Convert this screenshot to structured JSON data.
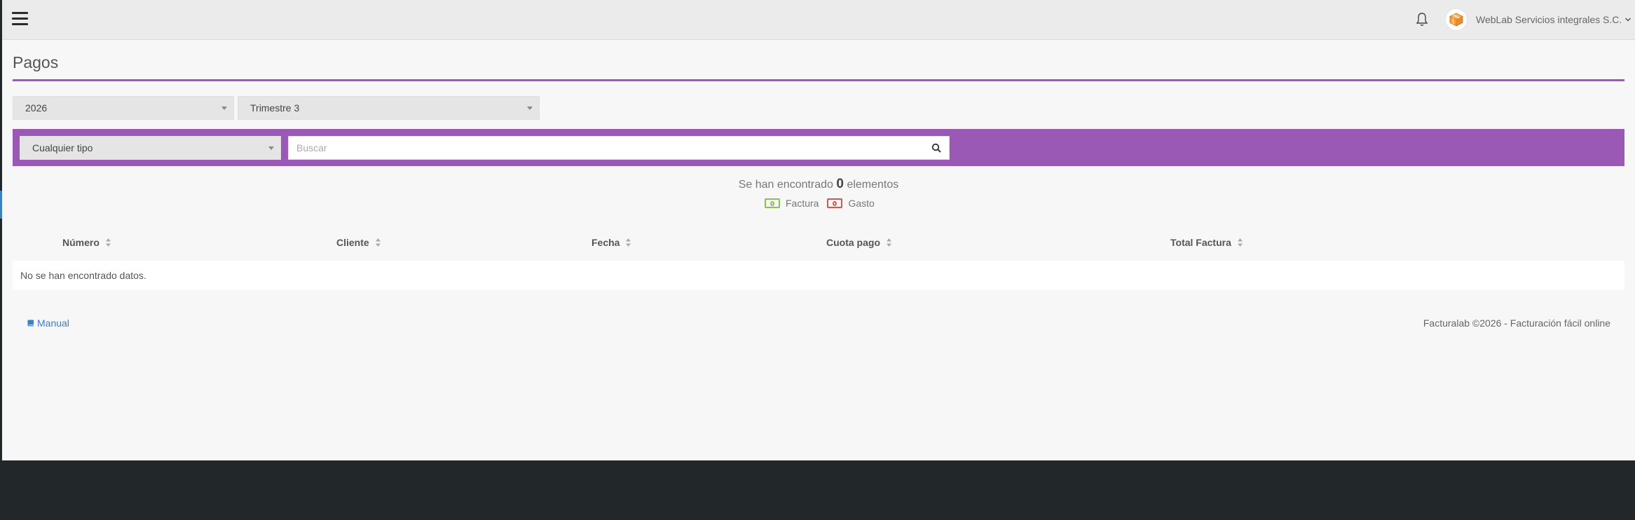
{
  "header": {
    "menu_icon": "hamburger-icon",
    "notification_icon": "bell-icon",
    "company_name": "WebLab Servicios integrales S.C.",
    "avatar_icon": "box-logo-icon"
  },
  "page_title": "Pagos",
  "filters": {
    "year": "2026",
    "quarter": "Trimestre 3",
    "type": "Cualquier tipo",
    "search_placeholder": "Buscar",
    "search_value": ""
  },
  "results": {
    "prefix": "Se han encontrado",
    "count": "0",
    "suffix": "elementos"
  },
  "legend": [
    {
      "label": "Factura",
      "color": "#8cc152",
      "icon": "money-bill-icon"
    },
    {
      "label": "Gasto",
      "color": "#d9534f",
      "icon": "money-bill-icon"
    }
  ],
  "table": {
    "columns": [
      "Número",
      "Cliente",
      "Fecha",
      "Cuota pago",
      "Total Factura"
    ],
    "empty_message": "No se han encontrado datos."
  },
  "footer": {
    "manual_label": "Manual",
    "copyright": "Facturalab ©2026 - Facturación fácil online"
  },
  "colors": {
    "accent": "#9b59b6",
    "link": "#3b7fc4",
    "dark_background": "#222829"
  }
}
